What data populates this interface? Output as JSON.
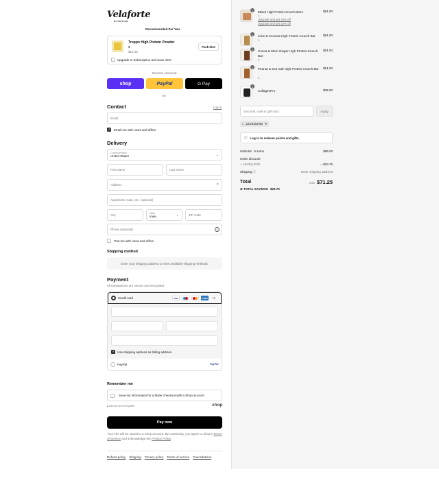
{
  "brand": {
    "name": "Velaforte",
    "tagline": "NUTRITION"
  },
  "recommended": {
    "title": "Recommended For You",
    "product_name": "Troppo High Protein Powder",
    "variant": "$",
    "price": "$14.00",
    "action": "Pack Size",
    "subscribe_label": "Upgrade to Subscription and Save 15%"
  },
  "express": {
    "label": "Express checkout",
    "shop": "shop",
    "paypal": "PayPal",
    "gpay": "G Pay",
    "or": "OR"
  },
  "contact": {
    "title": "Contact",
    "login": "Log in",
    "email_placeholder": "Email",
    "news_label": "Email me with news and offers"
  },
  "delivery": {
    "title": "Delivery",
    "country_label": "Country/Region",
    "country_value": "United States",
    "first_name": "First name",
    "last_name": "Last name",
    "address": "Address",
    "apartment": "Apartment, suite, etc. (optional)",
    "city": "City",
    "state_label": "State",
    "state_value": "Iowa",
    "zip": "ZIP code",
    "phone": "Phone (optional)",
    "text_label": "Text me with news and offers"
  },
  "shipping": {
    "title": "Shipping method",
    "note": "Enter your shipping address to view available shipping methods."
  },
  "payment": {
    "title": "Payment",
    "subtitle": "All transactions are secure and encrypted.",
    "credit_card": "Credit card",
    "more_cards": "+3",
    "billing_label": "Use shipping address as billing address",
    "paypal": "PayPal",
    "paypal_logo": "PayPal"
  },
  "remember": {
    "title": "Remember me",
    "save_label": "Save my information for a faster checkout with a Shop account",
    "secure": "Secure and encrypted",
    "shop": "shop"
  },
  "pay_button": "Pay now",
  "legal": {
    "text1": "Your info will be saved to a Shop account. By continuing, you agree to Shop's",
    "tos": "Terms of Service",
    "text2": "and acknowledge the",
    "privacy": "Privacy Policy",
    "period": "."
  },
  "footer_links": [
    "Refund policy",
    "Shipping",
    "Privacy policy",
    "Terms of service",
    "Cancellations"
  ],
  "cart": {
    "items": [
      {
        "qty": "1",
        "name": "Mixed High Protein Crunch Bars",
        "variant": "3",
        "upgrade1": "Upgrade and get 15% off",
        "upgrade2": "Upgrade and get 15% off",
        "price": "$14.00"
      },
      {
        "qty": "1",
        "name": "Lime & Coconut High Protein Crunch Bar",
        "variant": "3",
        "price": "$14.00"
      },
      {
        "qty": "1",
        "name": "Cocoa & Stem Ginger High Protein Crunch Bar",
        "variant": "3",
        "price": "$14.00"
      },
      {
        "qty": "1",
        "name": "Peanut & Sea Salt High Protein Crunch Bar",
        "variant": "3",
        "price": "$14.00"
      },
      {
        "qty": "1",
        "name": "CollagenPro",
        "price": "$39.00"
      }
    ],
    "discount_placeholder": "Discount code or gift card",
    "apply": "Apply",
    "code_tag": "LEVELUP25",
    "rewards": "Log in to redeem points and gifts.",
    "subtotal_label": "Subtotal · 5 items",
    "subtotal": "$95.00",
    "order_discount": "Order discount",
    "discount_code": "LEVELUP25",
    "discount_value": "– $23.75",
    "shipping_label": "Shipping",
    "shipping_value": "Enter shipping address",
    "total_label": "Total",
    "currency": "USD",
    "total": "$71.25",
    "savings_label": "TOTAL SAVINGS",
    "savings": "$23.75"
  }
}
